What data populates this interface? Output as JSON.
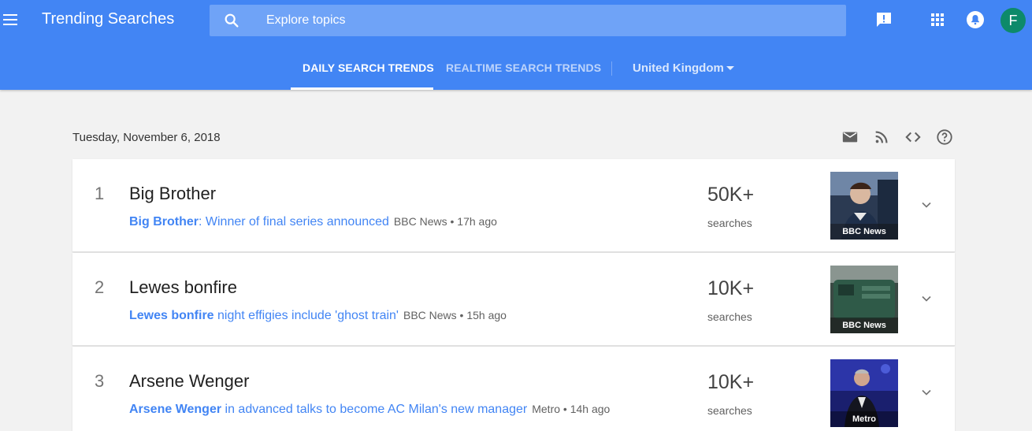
{
  "header": {
    "title": "Trending Searches",
    "search_placeholder": "Explore topics",
    "avatar_initial": "F"
  },
  "tabs": [
    {
      "label": "DAILY SEARCH TRENDS",
      "active": true
    },
    {
      "label": "REALTIME SEARCH TRENDS",
      "active": false
    }
  ],
  "region": "United Kingdom",
  "date": "Tuesday, November 6, 2018",
  "trends": [
    {
      "rank": "1",
      "term": "Big Brother",
      "article_highlight": "Big Brother",
      "article_rest": ": Winner of final series announced",
      "source": "BBC News • 17h ago",
      "count": "50K+",
      "count_label": "searches",
      "thumb_label": "BBC News"
    },
    {
      "rank": "2",
      "term": "Lewes bonfire",
      "article_highlight": "Lewes bonfire",
      "article_rest": " night effigies include 'ghost train'",
      "source": "BBC News • 15h ago",
      "count": "10K+",
      "count_label": "searches",
      "thumb_label": "BBC News"
    },
    {
      "rank": "3",
      "term": "Arsene Wenger",
      "article_highlight": "Arsene Wenger",
      "article_rest": " in advanced talks to become AC Milan's new manager",
      "source": "Metro • 14h ago",
      "count": "10K+",
      "count_label": "searches",
      "thumb_label": "Metro"
    }
  ],
  "colors": {
    "header_bg": "#4285f4",
    "link": "#4285f4",
    "avatar_bg": "#0d8a6a"
  },
  "icons": [
    "menu-icon",
    "search-icon",
    "feedback-icon",
    "apps-icon",
    "notifications-icon",
    "email-icon",
    "rss-icon",
    "embed-code-icon",
    "help-icon",
    "chevron-down-icon"
  ]
}
